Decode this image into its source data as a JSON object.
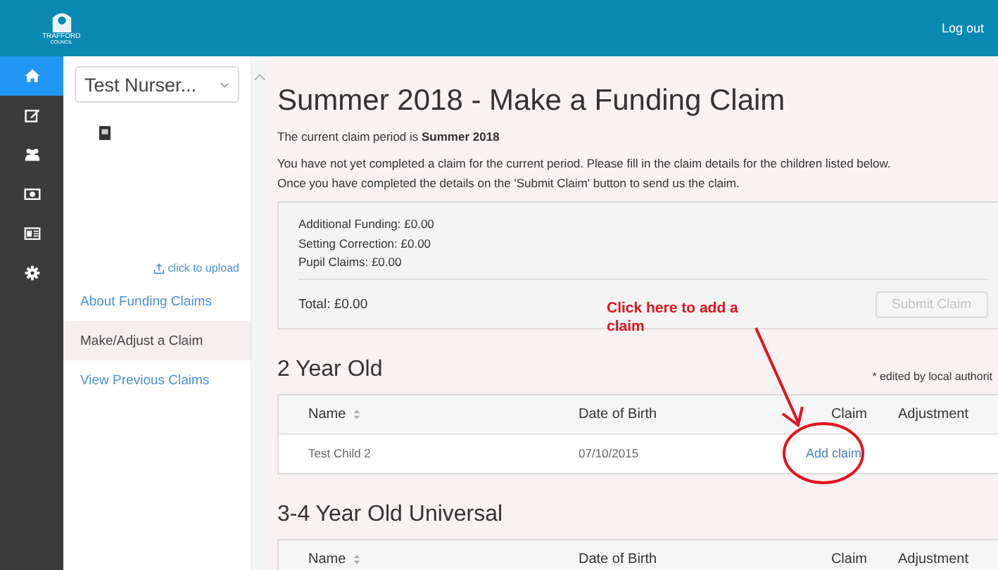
{
  "header": {
    "logo_text": "TRAFFORD",
    "logo_subtext": "COUNCIL",
    "logout": "Log out"
  },
  "rail": [
    {
      "selected": true
    },
    {
      "selected": false
    },
    {
      "selected": false
    },
    {
      "selected": false
    },
    {
      "selected": false
    },
    {
      "selected": false
    }
  ],
  "sidebar": {
    "setting_select": "Test Nurser...",
    "upload_link": "click to upload",
    "items": [
      {
        "label": "About Funding Claims",
        "selected": false
      },
      {
        "label": "Make/Adjust a Claim",
        "selected": true
      },
      {
        "label": "View Previous Claims",
        "selected": false
      }
    ]
  },
  "main": {
    "title": "Summer 2018 - Make a Funding Claim",
    "period_text": "The current claim period is **Summer 2018**",
    "intro": [
      "You have not yet completed a claim for the current period. Please fill in the claim details for the children listed below.",
      "Once you have completed the details on the 'Submit Claim' button to send us the claim."
    ],
    "summary": {
      "lines": [
        "Additional Funding: £0.00",
        "Setting Correction: £0.00",
        "Pupil Claims: £0.00"
      ],
      "total": "Total: £0.00",
      "submit_button": {
        "label": "Submit Claim",
        "disabled": true
      }
    },
    "sections": [
      {
        "title": "2 Year Old",
        "note": "* edited by local authorit",
        "columns": [
          "Name",
          "Date of Birth",
          "Claim",
          "Adjustment"
        ],
        "rows": [
          {
            "name": "Test Child 2",
            "dob": "07/10/2015",
            "claim": "Add claim"
          }
        ]
      },
      {
        "title": "3-4 Year Old Universal",
        "columns": [
          "Name",
          "Date of Birth",
          "Claim",
          "Adjustment"
        ]
      }
    ]
  },
  "annotation": {
    "text": "Click here to add a claim"
  }
}
